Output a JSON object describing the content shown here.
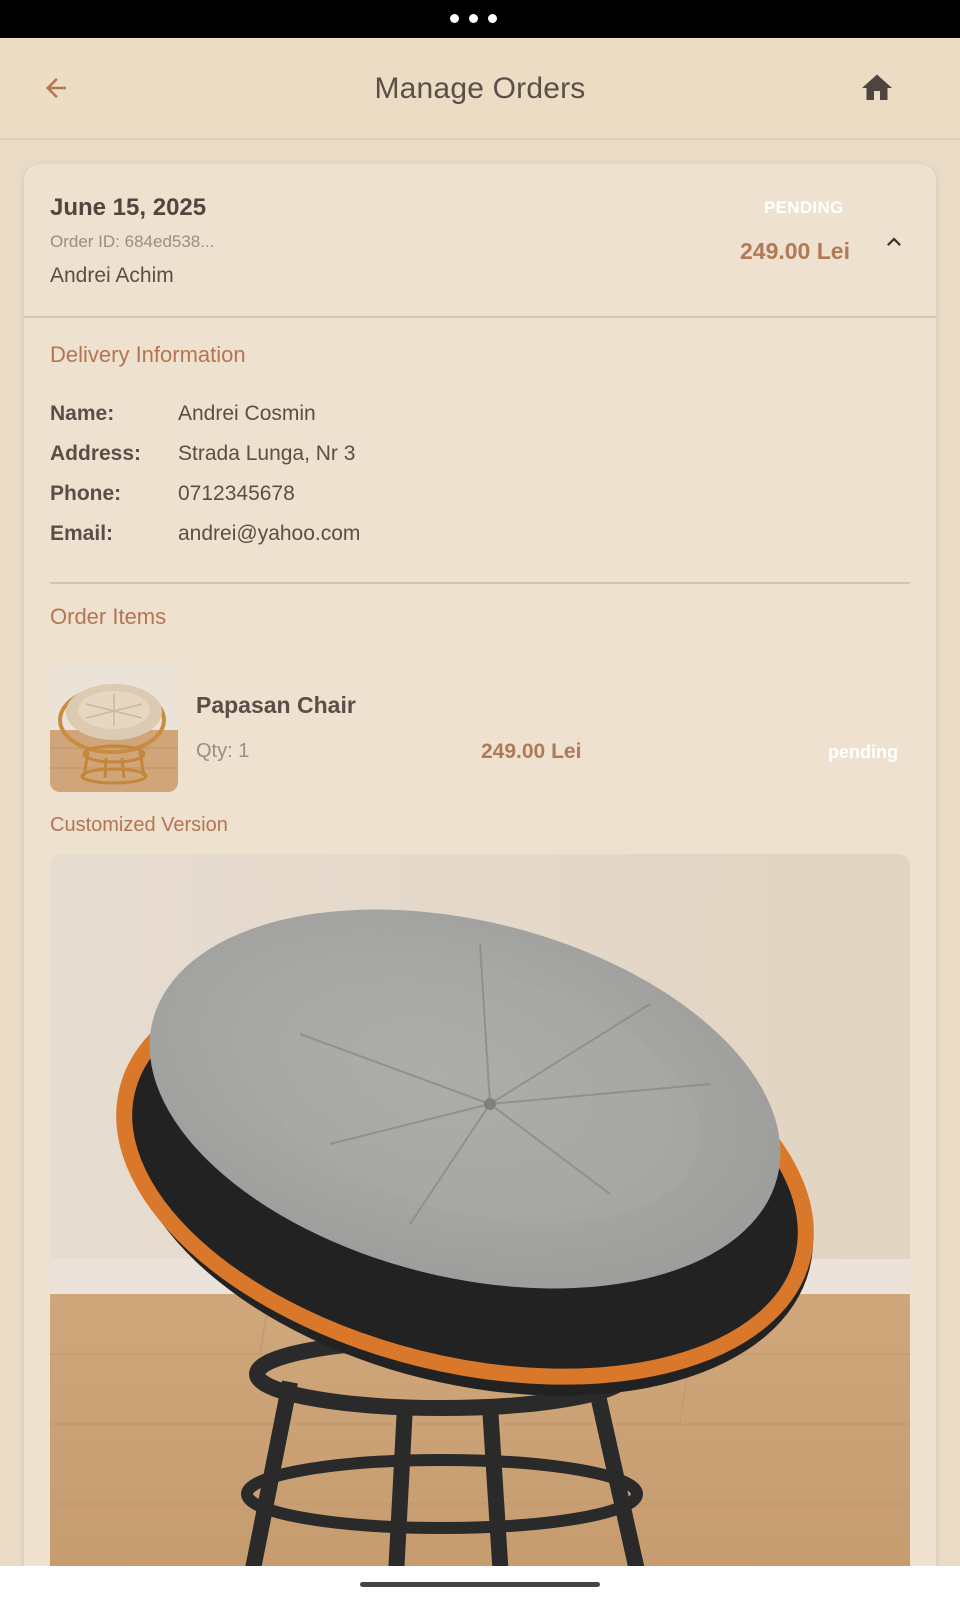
{
  "colors": {
    "background": "#e9dbc5",
    "appbar": "#ecdcc3",
    "card": "#efe1cf",
    "accent": "#b07a56",
    "text_primary": "#5a4f48",
    "text_secondary": "#9a8e85"
  },
  "appbar": {
    "title": "Manage Orders",
    "back_icon": "arrow-left-icon",
    "home_icon": "home-icon"
  },
  "order": {
    "date": "June 15, 2025",
    "order_id": "Order ID: 684ed538...",
    "customer": "Andrei Achim",
    "status": "PENDING",
    "total": "249.00 Lei",
    "collapse_icon": "chevron-up-icon"
  },
  "delivery": {
    "title": "Delivery Information",
    "rows": [
      {
        "label": "Name:",
        "value": "Andrei Cosmin"
      },
      {
        "label": "Address:",
        "value": "Strada Lunga, Nr 3"
      },
      {
        "label": "Phone:",
        "value": "0712345678"
      },
      {
        "label": "Email:",
        "value": "andrei@yahoo.com"
      }
    ]
  },
  "items": {
    "title": "Order Items",
    "list": [
      {
        "name": "Papasan Chair",
        "qty": "Qty: 1",
        "price": "249.00 Lei",
        "status": "pending"
      }
    ]
  },
  "customized": {
    "title": "Customized Version"
  }
}
